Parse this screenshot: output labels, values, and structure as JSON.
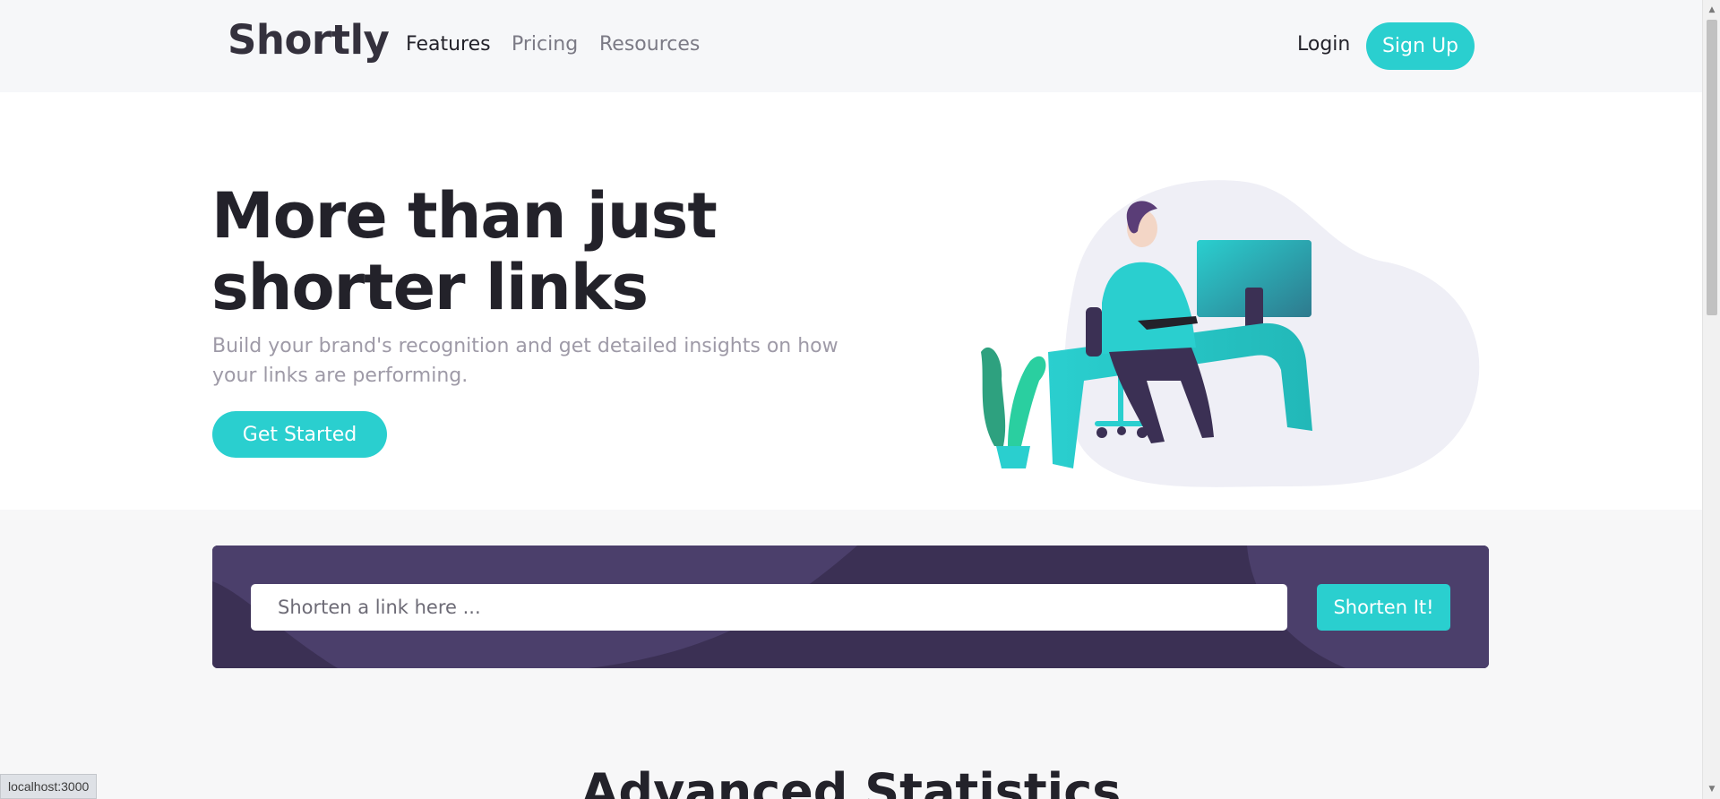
{
  "nav": {
    "logo": "Shortly",
    "links": [
      {
        "label": "Features",
        "active": true
      },
      {
        "label": "Pricing",
        "active": false
      },
      {
        "label": "Resources",
        "active": false
      }
    ],
    "login": "Login",
    "signup": "Sign Up"
  },
  "hero": {
    "title_line1": "More than just",
    "title_line2": "shorter links",
    "subtitle": "Build your brand's recognition and get detailed insights on how your links are performing.",
    "cta": "Get Started",
    "illustration": "person-working-at-desk-illustration"
  },
  "shorten": {
    "placeholder": "Shorten a link here ...",
    "value": "",
    "button": "Shorten It!"
  },
  "stats": {
    "heading": "Advanced Statistics"
  },
  "browser": {
    "status_url": "localhost:3000"
  },
  "colors": {
    "cyan": "#2acfcf",
    "dark_violet": "#3b3054",
    "grayish_violet": "#9e9aa7",
    "very_dark_blue": "#23222a"
  }
}
